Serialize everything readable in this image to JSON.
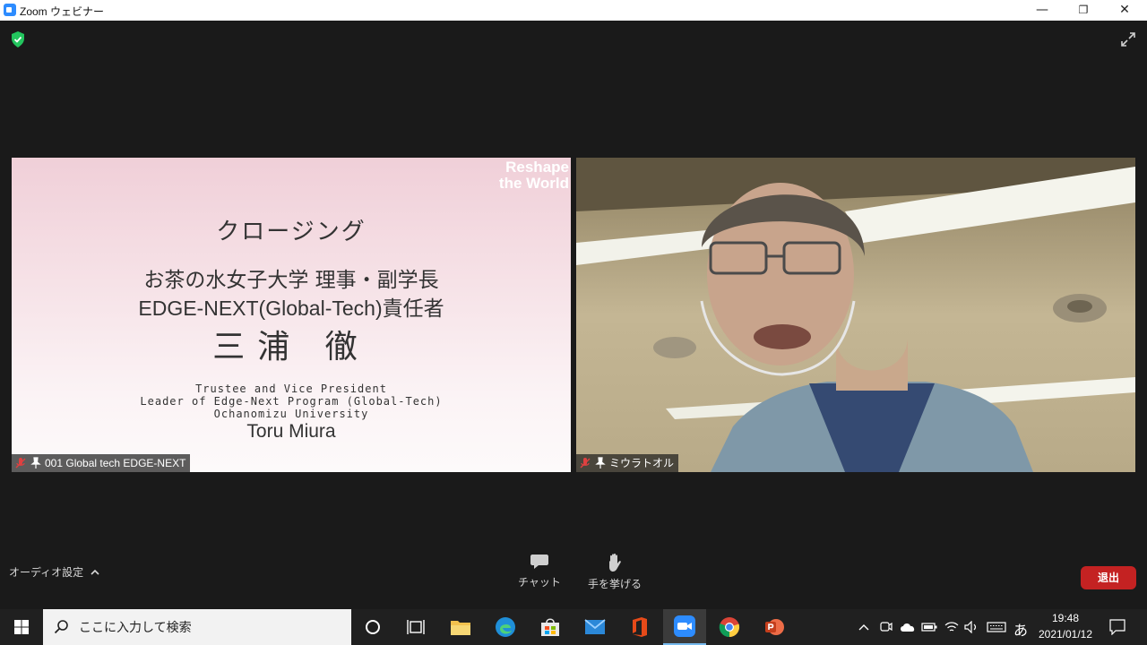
{
  "window": {
    "title": "Zoom ウェビナー",
    "minimize": "—",
    "restore": "❐",
    "close": "✕"
  },
  "slide": {
    "badge_line1": "Reshape",
    "badge_line2": "the World",
    "title": "クロージング",
    "affiliation": "お茶の水女子大学 理事・副学長",
    "role": "EDGE-NEXT(Global-Tech)責任者",
    "name_jp": "三浦 徹",
    "en_line1": "Trustee and Vice President",
    "en_line2": "Leader of Edge-Next Program (Global-Tech)",
    "en_line3": "Ochanomizu University",
    "name_en": "Toru Miura"
  },
  "participants": [
    {
      "label": "001 Global tech EDGE-NEXT"
    },
    {
      "label": "ミウラトオル"
    }
  ],
  "toolbar": {
    "audio_settings": "オーディオ設定",
    "chat": "チャット",
    "raise_hand": "手を挙げる",
    "leave": "退出"
  },
  "taskbar": {
    "search_placeholder": "ここに入力して検索",
    "ime": "あ",
    "time": "19:48",
    "date": "2021/01/12"
  },
  "colors": {
    "accent": "#2d8cff",
    "leave": "#c42222",
    "security": "#23c55e"
  }
}
